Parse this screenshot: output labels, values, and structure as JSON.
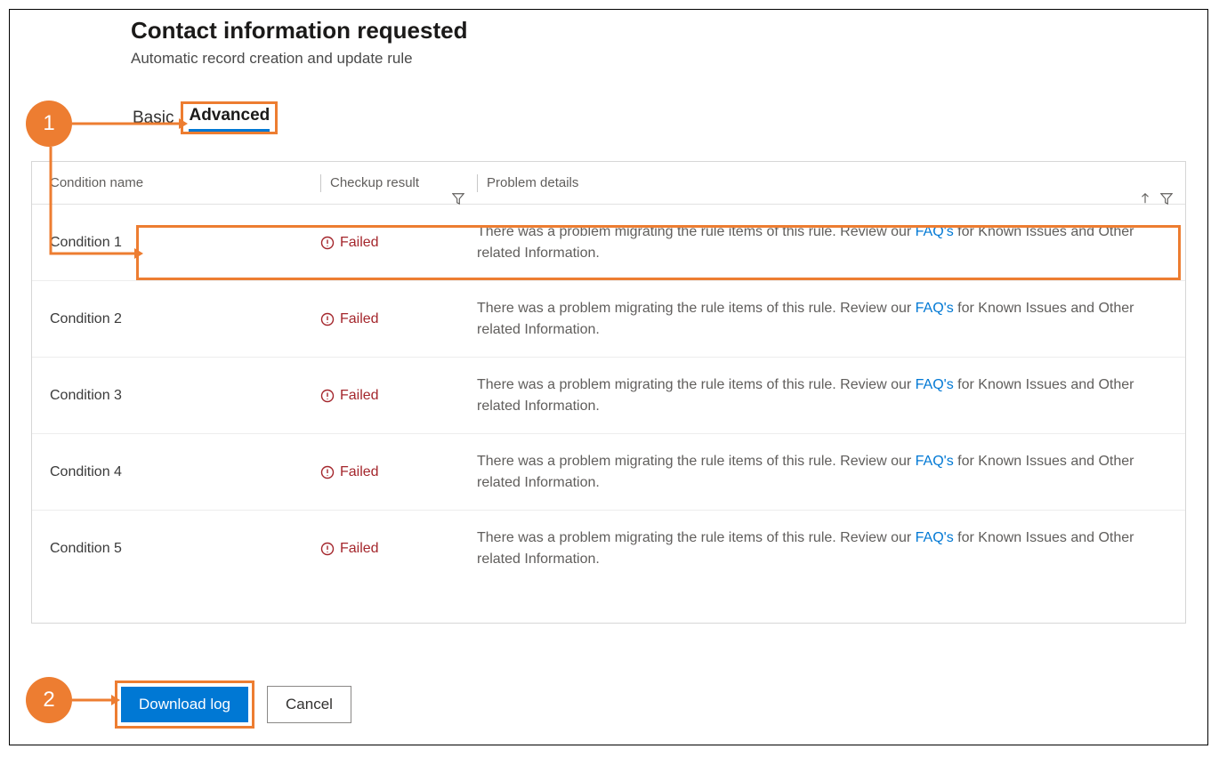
{
  "header": {
    "title": "Contact information requested",
    "subtitle": "Automatic record creation and update rule"
  },
  "tabs": {
    "basic": "Basic",
    "advanced": "Advanced"
  },
  "columns": {
    "name": "Condition name",
    "result": "Checkup result",
    "details": "Problem details"
  },
  "faq_label": "FAQ's",
  "rows": [
    {
      "name": "Condition 1",
      "result": "Failed",
      "detail_pre": "There was a problem migrating the rule items of this rule. Review our ",
      "detail_post": " for Known Issues and Other related Information."
    },
    {
      "name": "Condition 2",
      "result": "Failed",
      "detail_pre": "There was a problem migrating the rule items of this rule. Review our ",
      "detail_post": " for Known Issues and Other related Information."
    },
    {
      "name": "Condition 3",
      "result": "Failed",
      "detail_pre": "There was a problem migrating the rule items of this rule. Review our ",
      "detail_post": " for Known Issues and Other related Information."
    },
    {
      "name": "Condition 4",
      "result": "Failed",
      "detail_pre": "There was a problem migrating the rule items of this rule. Review our ",
      "detail_post": " for Known Issues and Other related Information."
    },
    {
      "name": "Condition 5",
      "result": "Failed",
      "detail_pre": "There was a problem migrating the rule items of this rule. Review our ",
      "detail_post": " for Known Issues and Other related Information."
    }
  ],
  "buttons": {
    "download": "Download log",
    "cancel": "Cancel"
  },
  "callouts": {
    "c1": "1",
    "c2": "2"
  }
}
